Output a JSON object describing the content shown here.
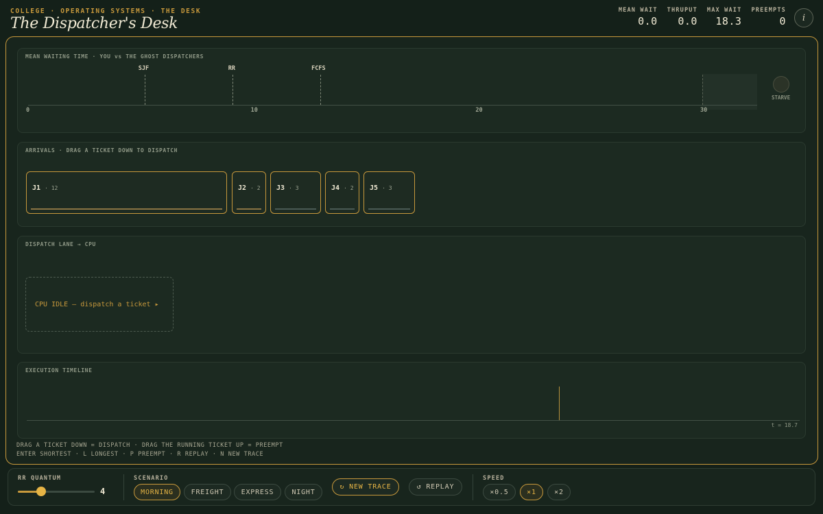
{
  "header": {
    "breadcrumb": "COLLEGE · OPERATING SYSTEMS · THE DESK",
    "title": "The Dispatcher's Desk",
    "stats": [
      {
        "label": "MEAN WAIT",
        "value": "0.0"
      },
      {
        "label": "THRUPUT",
        "value": "0.0"
      },
      {
        "label": "MAX WAIT",
        "value": "18.3"
      },
      {
        "label": "PREEMPTS",
        "value": "0"
      }
    ],
    "help_icon": "info-icon",
    "help_glyph": "i"
  },
  "mean_panel": {
    "label": "MEAN WAITING TIME  ·  YOU vs THE GHOST DISPATCHERS",
    "axis_ticks": [
      "0",
      "10",
      "20",
      "30"
    ],
    "axis_range": [
      0,
      30
    ],
    "ghosts": [
      {
        "name": "SJF",
        "value": 5.2
      },
      {
        "name": "RR",
        "value": 9.1
      },
      {
        "name": "FCFS",
        "value": 13.0
      }
    ],
    "starve_threshold": 30,
    "starve_label": "STARVE"
  },
  "arrivals": {
    "label": "ARRIVALS  ·  DRAG A TICKET DOWN TO DISPATCH",
    "tickets": [
      {
        "id": "J1",
        "burst": "12"
      },
      {
        "id": "J2",
        "burst": "2"
      },
      {
        "id": "J3",
        "burst": "3"
      },
      {
        "id": "J4",
        "burst": "2"
      },
      {
        "id": "J5",
        "burst": "3"
      }
    ]
  },
  "lane": {
    "label": "DISPATCH LANE  →  CPU",
    "idle_text": "CPU IDLE — dispatch a ticket ▸"
  },
  "timeline": {
    "label": "EXECUTION TIMELINE",
    "time": "t = 18.7"
  },
  "hints": {
    "line1": "DRAG A TICKET DOWN = DISPATCH · DRAG THE RUNNING TICKET UP = PREEMPT",
    "line2": "ENTER SHORTEST · L LONGEST · P PREEMPT · R REPLAY · N NEW TRACE"
  },
  "controls": {
    "quantum_label": "RR QUANTUM",
    "quantum_value": "4",
    "quantum_level": 0.3,
    "scenario_label": "SCENARIO",
    "scenarios": [
      "MORNING",
      "FREIGHT",
      "EXPRESS",
      "NIGHT"
    ],
    "scenario_active": "MORNING",
    "new_trace": "↻ NEW TRACE",
    "replay": "↺ REPLAY",
    "speed_label": "SPEED",
    "speeds": [
      "×0.5",
      "×1",
      "×2"
    ],
    "speed_active": "×1"
  },
  "colors": {
    "accent": "#c8993c",
    "background": "#142019",
    "panel": "#1c2a21",
    "text": "#f1ead4"
  }
}
